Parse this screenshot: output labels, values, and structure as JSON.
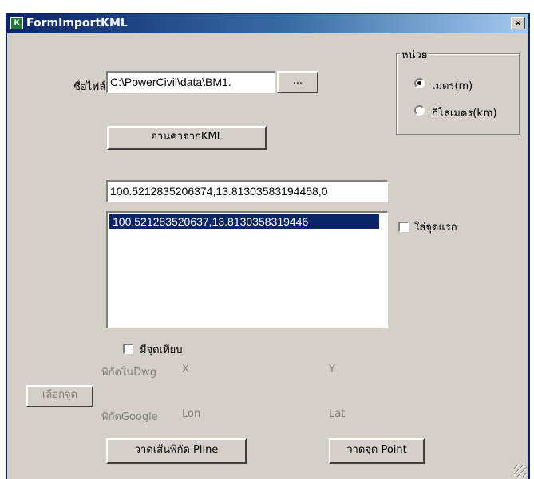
{
  "window": {
    "title": "FormImportKML",
    "close": "×"
  },
  "file": {
    "label": "ชื่อไฟล์",
    "path": "C:\\PowerCivil\\data\\BM1.",
    "browse_label": "..."
  },
  "read_button": "อ่านค่าจากKML",
  "units": {
    "legend": "หน่วย",
    "options": [
      {
        "label": "เมตร(m)",
        "selected": true
      },
      {
        "label": "กิโลเมตร(km)",
        "selected": false
      }
    ]
  },
  "coord_input": "100.5212835206374,13.81303583194458,0",
  "coord_list": [
    "100.521283520637,13.8130358319446"
  ],
  "first_point_checkbox": "ใส่จุดแรก",
  "benchmark_checkbox": "มีจุดเทียบ",
  "select_point_button": "เลือกจุด",
  "dwg": {
    "label": "พิกัดในDwg",
    "x": "X",
    "y": "Y"
  },
  "google": {
    "label": "พิกัดGoogle",
    "lon": "Lon",
    "lat": "Lat"
  },
  "draw_pline_button": "วาดเส้นพิกัด Pline",
  "draw_point_button": "วาดจุด Point"
}
